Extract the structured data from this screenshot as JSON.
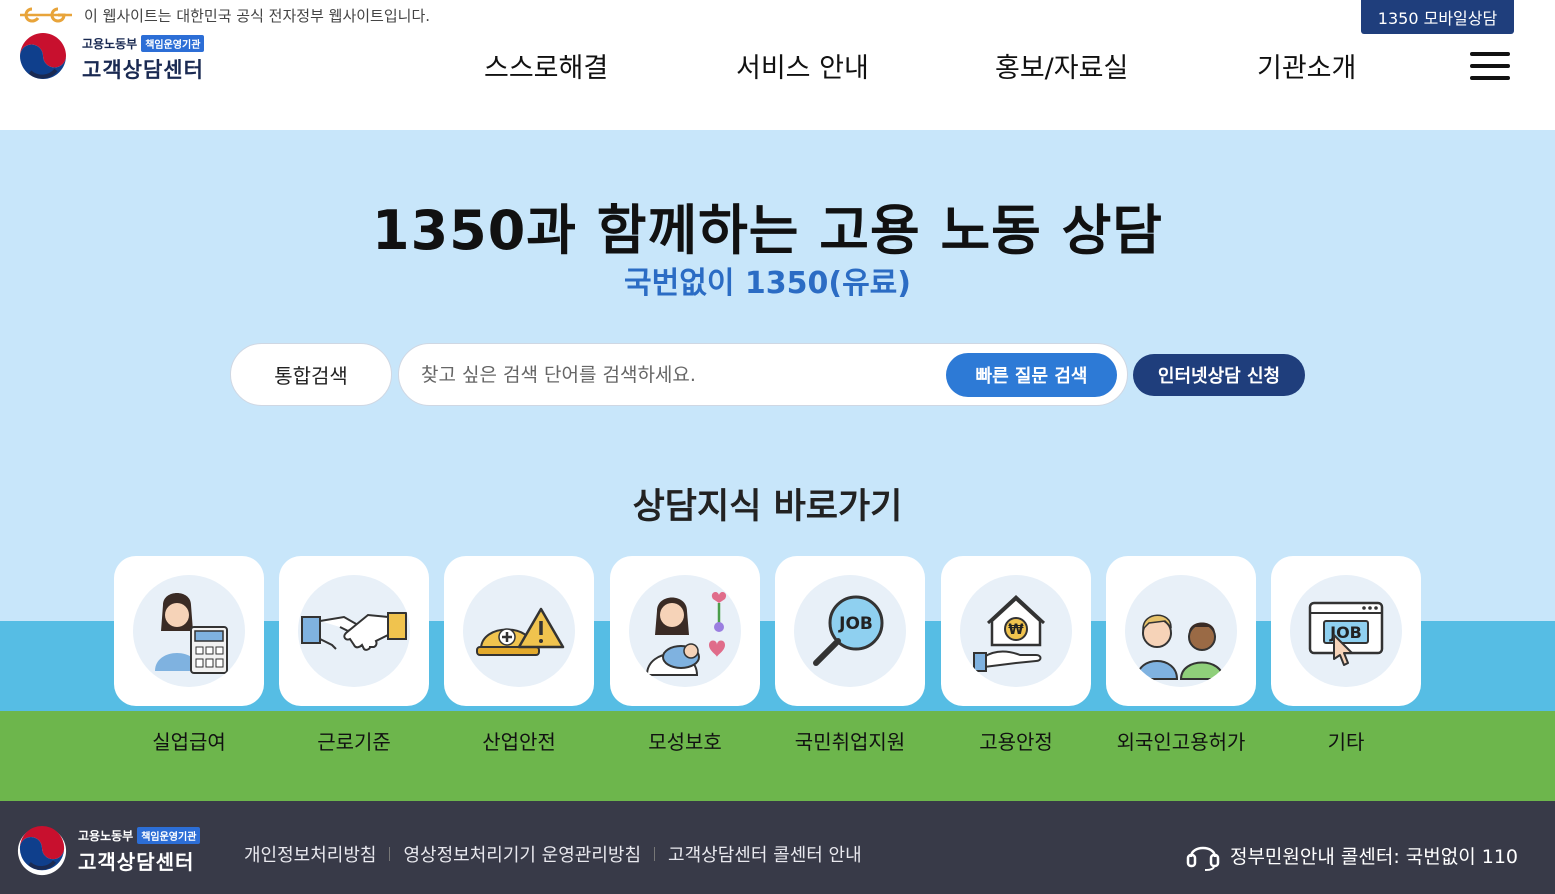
{
  "header": {
    "gov_notice": "이 웹사이트는 대한민국 공식 전자정부 웹사이트입니다.",
    "mobile_button": "1350 모바일상담",
    "logo_top": "고용노동부",
    "logo_badge": "책임운영기관",
    "logo_main": "고객상담센터",
    "nav": [
      {
        "label": "스스로해결"
      },
      {
        "label": "서비스 안내"
      },
      {
        "label": "홍보/자료실"
      },
      {
        "label": "기관소개"
      }
    ]
  },
  "hero": {
    "title": "1350과 함께하는 고용 노동 상담",
    "subtitle": "국번없이 1350(유료)",
    "search_tab": "통합검색",
    "search_placeholder": "찾고 싶은 검색 단어를 검색하세요.",
    "quick_search_button": "빠른 질문 검색",
    "internet_consult_button": "인터넷상담 신청"
  },
  "shortcuts": {
    "title": "상담지식 바로가기",
    "items": [
      {
        "label": "실업급여",
        "icon": "woman-calculator-icon"
      },
      {
        "label": "근로기준",
        "icon": "handshake-icon"
      },
      {
        "label": "산업안전",
        "icon": "safety-helmet-warning-icon"
      },
      {
        "label": "모성보호",
        "icon": "mother-baby-icon"
      },
      {
        "label": "국민취업지원",
        "icon": "job-magnifier-icon"
      },
      {
        "label": "고용안정",
        "icon": "house-won-hand-icon"
      },
      {
        "label": "외국인고용허가",
        "icon": "foreign-workers-icon"
      },
      {
        "label": "기타",
        "icon": "job-browser-icon"
      }
    ]
  },
  "footer": {
    "logo_top": "고용노동부",
    "logo_badge": "책임운영기관",
    "logo_main": "고객상담센터",
    "links": [
      {
        "label": "개인정보처리방침"
      },
      {
        "label": "영상정보처리기기 운영관리방침"
      },
      {
        "label": "고객상담센터 콜센터 안내"
      }
    ],
    "call_center": "정부민원안내 콜센터: 국번없이 110"
  },
  "colors": {
    "navy": "#1f3e7c",
    "blue": "#2d7ad6",
    "sky": "#c8e6fa",
    "water": "#56bde4",
    "grass": "#6db64c",
    "footer_bg": "#383a48"
  }
}
